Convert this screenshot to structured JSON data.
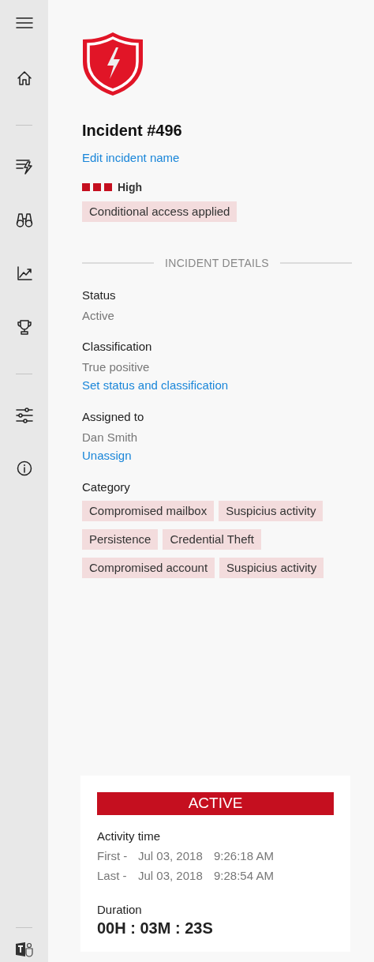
{
  "sidebar": {
    "items": [
      {
        "kind": "menu"
      },
      {
        "kind": "home"
      },
      {
        "kind": "divider"
      },
      {
        "kind": "alerts"
      },
      {
        "kind": "hunt"
      },
      {
        "kind": "chart"
      },
      {
        "kind": "trophy"
      },
      {
        "kind": "divider"
      },
      {
        "kind": "sliders"
      },
      {
        "kind": "info"
      }
    ],
    "bottom_items": [
      {
        "kind": "divider"
      },
      {
        "kind": "app"
      }
    ]
  },
  "incident": {
    "title": "Incident #496",
    "edit_link": "Edit incident name",
    "severity": {
      "label": "High",
      "stars": 3
    },
    "tags": [
      "Conditional access applied"
    ]
  },
  "details": {
    "heading": "INCIDENT DETAILS",
    "fields": [
      {
        "label": "Status",
        "value": "Active"
      },
      {
        "label": "Classification",
        "value": "True positive",
        "link": "Set status and classification"
      },
      {
        "label": "Assigned to",
        "value": "Dan Smith",
        "link": "Unassign"
      }
    ],
    "category": {
      "label": "Category",
      "tags": [
        "Compromised mailbox",
        "Suspicius activity",
        "Persistence",
        "Credential Theft",
        "Compromised account",
        "Suspicius activity"
      ]
    }
  },
  "activity_card": {
    "status": "ACTIVE",
    "activity_label": "Activity time",
    "times": [
      {
        "label": "First -",
        "date": "Jul 03, 2018",
        "time": "9:26:18 AM"
      },
      {
        "label": "Last -",
        "date": "Jul 03, 2018",
        "time": "9:28:54 AM"
      }
    ],
    "duration_label": "Duration",
    "duration": "00H : 03M : 23S"
  }
}
